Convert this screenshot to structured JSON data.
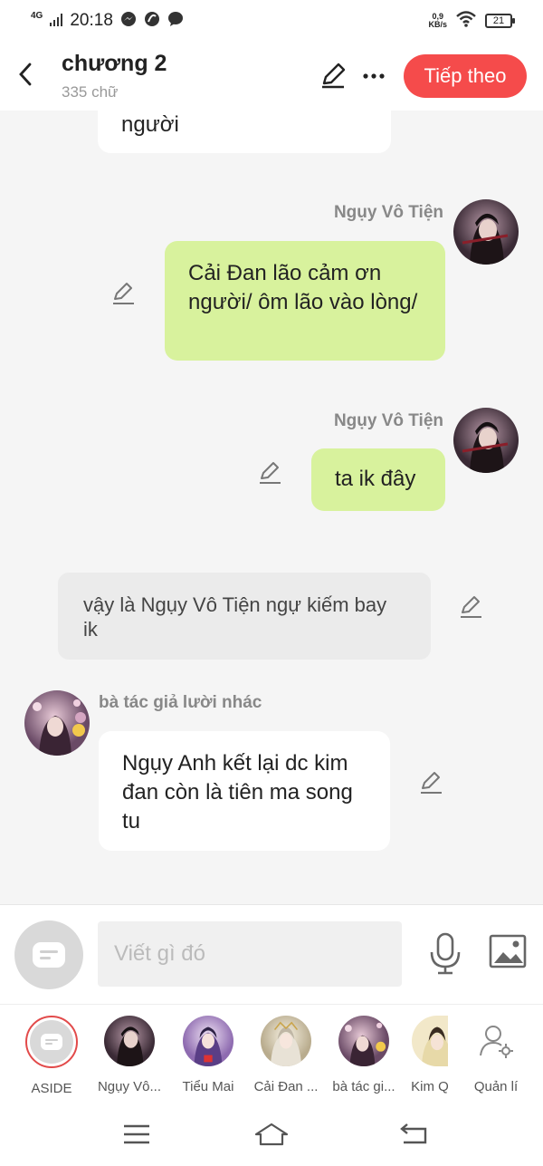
{
  "status_bar": {
    "network": "4G",
    "time": "20:18",
    "speed_value": "0,9",
    "speed_unit": "KB/s",
    "battery": "21"
  },
  "header": {
    "title": "chương 2",
    "word_count": "335 chữ",
    "next_label": "Tiếp theo"
  },
  "messages": {
    "m0": {
      "text": "người"
    },
    "m1": {
      "name": "Ngụy Vô Tiện",
      "text": "Cải Đan lão cảm ơn người/ ôm lão vào lòng/"
    },
    "m2": {
      "name": "Ngụy Vô Tiện",
      "text": "ta ik đây"
    },
    "m3": {
      "text": "vậy là Ngụy Vô Tiện ngự kiếm bay ik"
    },
    "m4": {
      "name": "bà tác giả lười nhác",
      "text": "Ngụy Anh kết lại dc kim đan còn là tiên ma song tu"
    }
  },
  "input": {
    "placeholder": "Viết gì đó"
  },
  "characters": [
    {
      "label": "ASIDE"
    },
    {
      "label": "Ngụy Vô..."
    },
    {
      "label": "Tiểu Mai"
    },
    {
      "label": "Cải Đan ..."
    },
    {
      "label": "bà tác gi..."
    },
    {
      "label": "Kim Q"
    },
    {
      "label": "Quản lí"
    }
  ],
  "colors": {
    "accent": "#f54b4b",
    "bubble_green": "#d8f29d",
    "background": "#f5f5f5"
  }
}
